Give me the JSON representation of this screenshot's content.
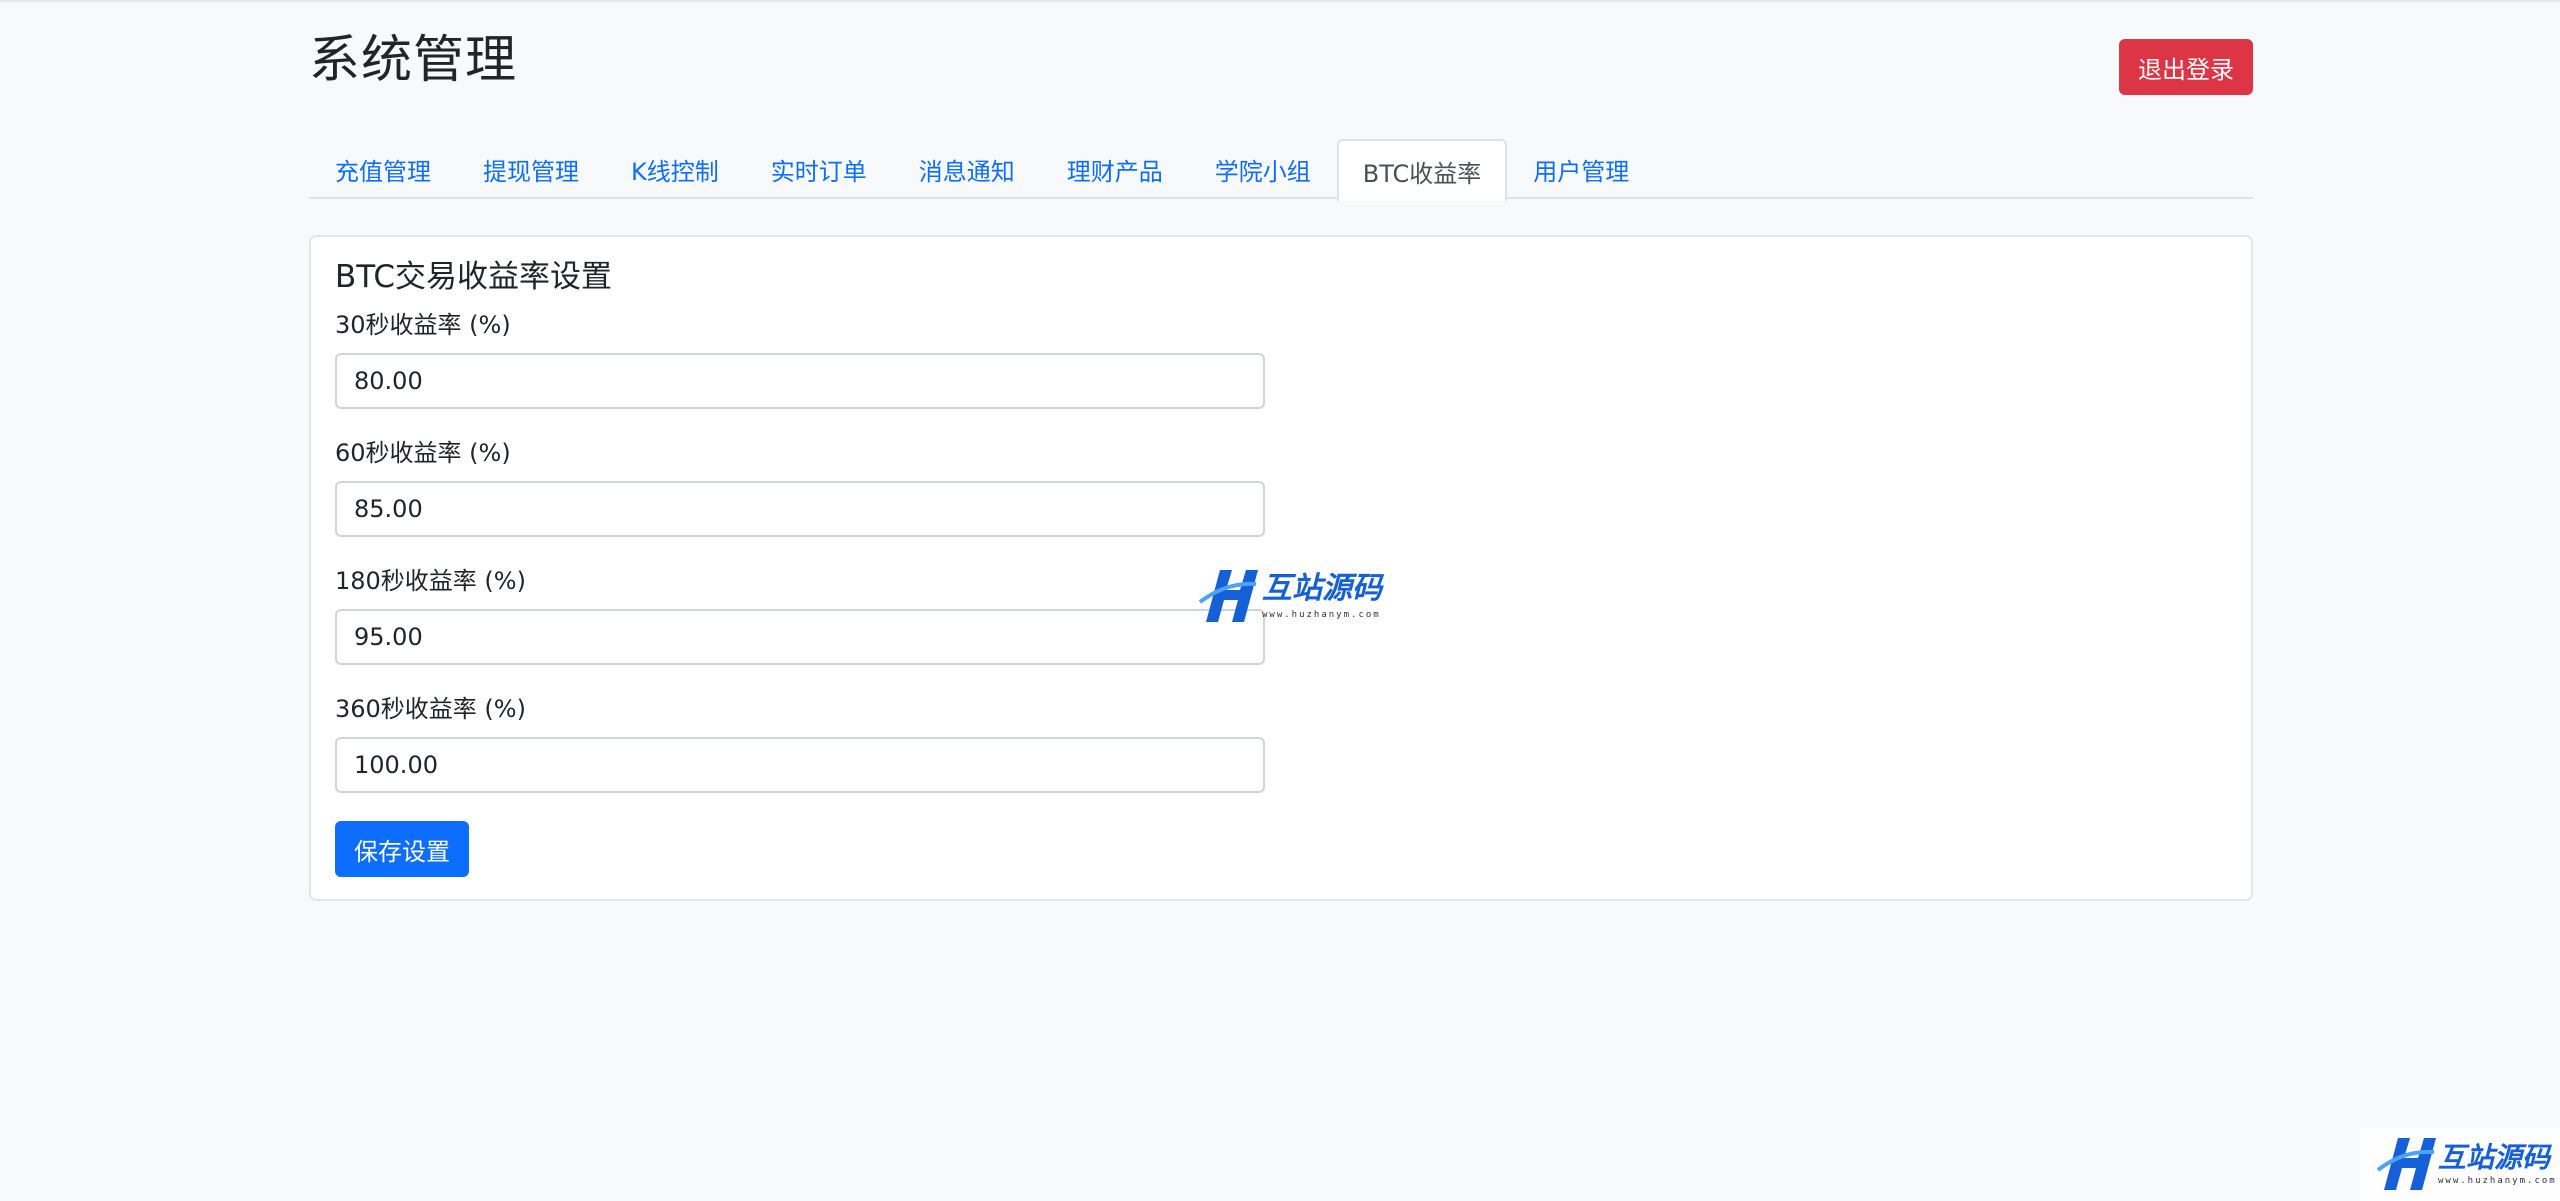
{
  "header": {
    "title": "系统管理",
    "logout_label": "退出登录"
  },
  "tabs": [
    {
      "label": "充值管理",
      "active": false
    },
    {
      "label": "提现管理",
      "active": false
    },
    {
      "label": "K线控制",
      "active": false
    },
    {
      "label": "实时订单",
      "active": false
    },
    {
      "label": "消息通知",
      "active": false
    },
    {
      "label": "理财产品",
      "active": false
    },
    {
      "label": "学院小组",
      "active": false
    },
    {
      "label": "BTC收益率",
      "active": true
    },
    {
      "label": "用户管理",
      "active": false
    }
  ],
  "form": {
    "title": "BTC交易收益率设置",
    "fields": [
      {
        "label": "30秒收益率 (%)",
        "value": "80.00"
      },
      {
        "label": "60秒收益率 (%)",
        "value": "85.00"
      },
      {
        "label": "180秒收益率 (%)",
        "value": "95.00"
      },
      {
        "label": "360秒收益率 (%)",
        "value": "100.00"
      }
    ],
    "save_label": "保存设置"
  },
  "watermark": {
    "text": "互站源码",
    "url": "www.huzhanym.com"
  },
  "colors": {
    "primary": "#0d6efd",
    "danger": "#dc3545",
    "background": "#f8f9fa"
  }
}
